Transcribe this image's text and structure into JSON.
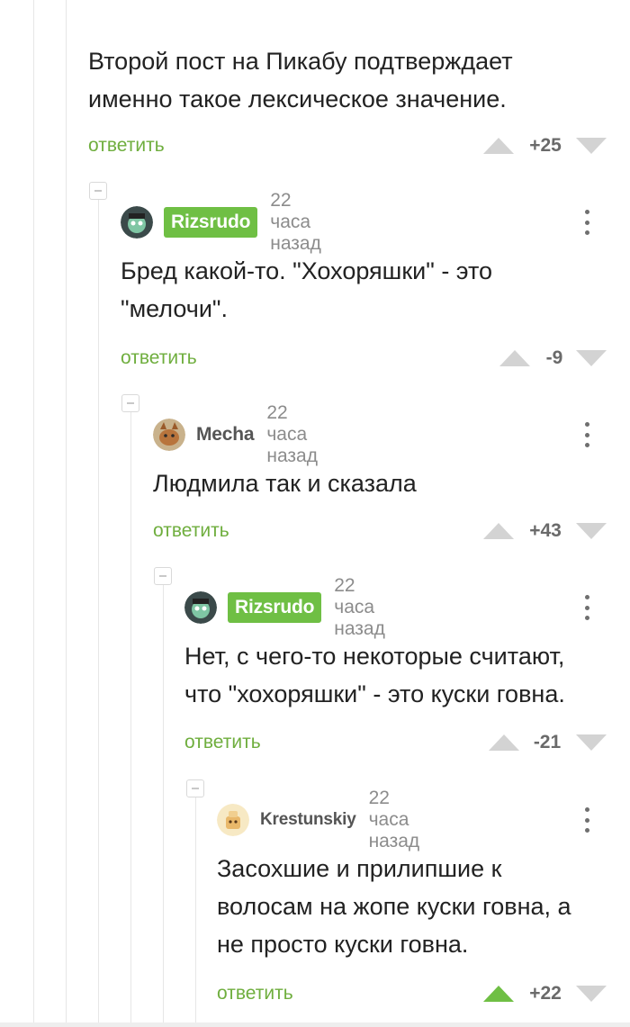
{
  "colors": {
    "accent": "#6fbf44",
    "reply": "#6fae3e",
    "upvote_active": "#6fbf44",
    "vote_inactive": "#d3d3d3"
  },
  "top_comment": {
    "text_line1": "Второй пост на Пикабу подтверждает",
    "text_line2": "именно такое лексическое значение.",
    "reply_label": "ответить",
    "rating": "+25"
  },
  "comments": [
    {
      "author": "Rizsrudo",
      "time": "22 часа назад",
      "text_line1": "Бред какой-то. \"Хохоряшки\" - это",
      "text_line2": "\"мелочи\".",
      "reply_label": "ответить",
      "rating": "-9"
    },
    {
      "author": "Mecha",
      "time": "22 часа назад",
      "text_line1": "Людмила так и сказала",
      "reply_label": "ответить",
      "rating": "+43"
    },
    {
      "author": "Rizsrudo",
      "time": "22 часа назад",
      "text_line1": "Нет, с чего-то некоторые считают,",
      "text_line2": "что \"хохоряшки\" - это куски говна.",
      "reply_label": "ответить",
      "rating": "-21"
    },
    {
      "author": "Krestunskiy",
      "time": "22 часа назад",
      "text_line1": "Засохшие и прилипшие к",
      "text_line2": "волосам на жопе куски говна, а",
      "text_line3": "не просто куски говна.",
      "reply_label": "ответить",
      "rating": "+22",
      "upvoted": true
    }
  ]
}
